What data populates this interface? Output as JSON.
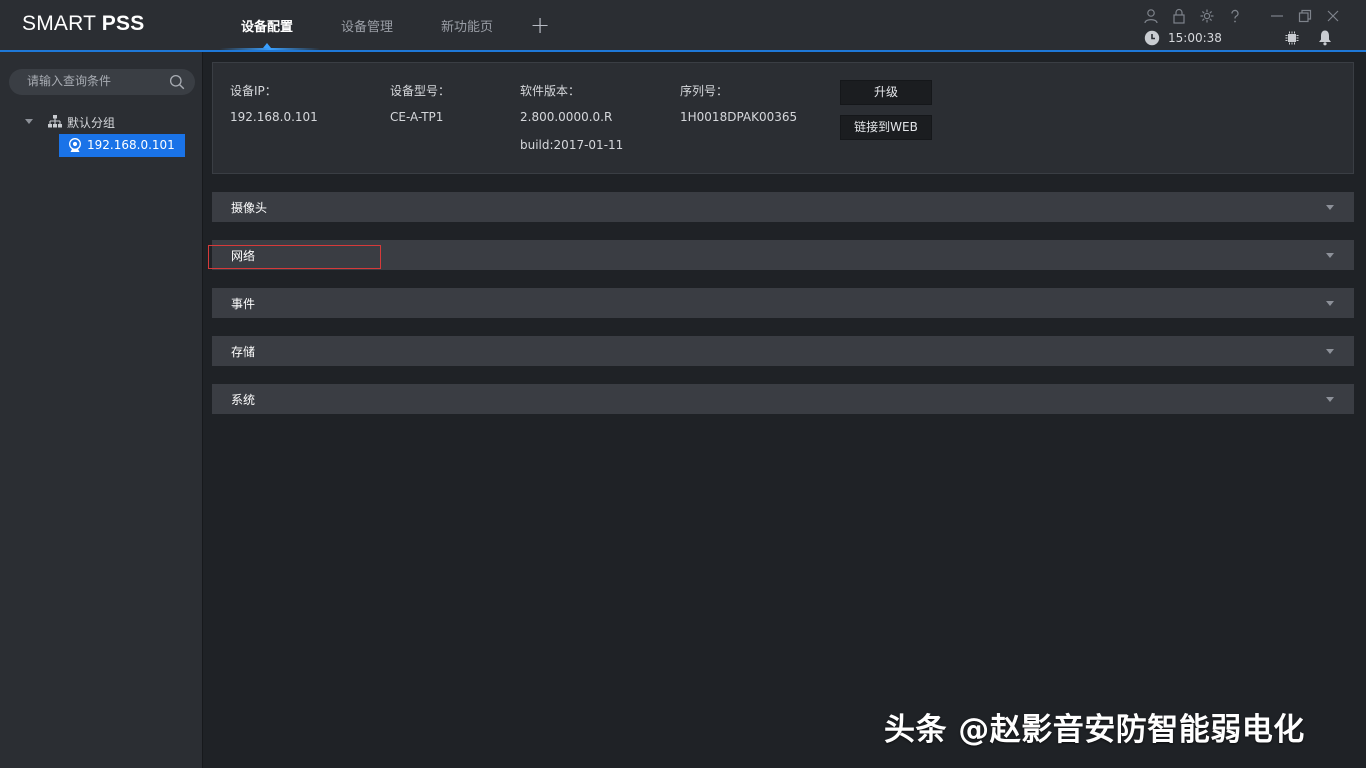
{
  "app": {
    "logo_light": "SMART ",
    "logo_bold": "PSS"
  },
  "tabs": [
    {
      "label": "设备配置",
      "active": true
    },
    {
      "label": "设备管理",
      "active": false
    },
    {
      "label": "新功能页",
      "active": false
    }
  ],
  "add_tab": "+",
  "status": {
    "time": "15:00:38"
  },
  "sidebar": {
    "search_placeholder": "请输入查询条件",
    "group_label": "默认分组",
    "device_label": "192.168.0.101"
  },
  "device_info": {
    "ip_label": "设备IP：",
    "ip_value": "192.168.0.101",
    "model_label": "设备型号：",
    "model_value": "CE-A-TP1",
    "software_label": "软件版本：",
    "software_value": "2.800.0000.0.R",
    "build_value": "build:2017-01-11",
    "serial_label": "序列号：",
    "serial_value": "1H0018DPAK00365",
    "upgrade_button": "升级",
    "web_button": "链接到WEB"
  },
  "sections": [
    {
      "label": "摄像头"
    },
    {
      "label": "网络"
    },
    {
      "label": "事件"
    },
    {
      "label": "存储"
    },
    {
      "label": "系统"
    }
  ],
  "watermark": "头条 @赵影音安防智能弱电化",
  "colors": {
    "accent": "#1e78d8",
    "selection": "#1a73e8",
    "highlight": "#d63a3a"
  }
}
